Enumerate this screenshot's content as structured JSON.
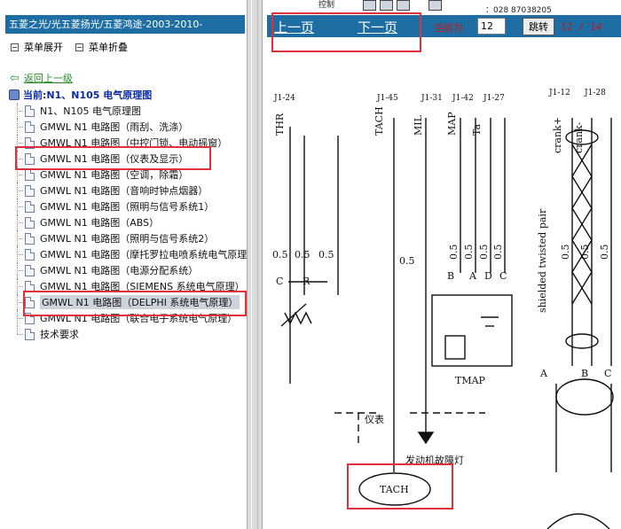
{
  "tree": {
    "title": "五菱之光/光五菱扬光/五菱鸿途-2003-2010-",
    "expand_label": "菜单展开",
    "collapse_label": "菜单折叠",
    "back_label": "返回上一级",
    "current_path": "当前:N1、N105 电气原理图",
    "items": [
      {
        "label": "N1、N105 电气原理图"
      },
      {
        "label": "GMWL N1 电路图（雨刮、洗涤）"
      },
      {
        "label": "GMWL N1 电路图（中控门锁、电动摇窗）"
      },
      {
        "label": "GMWL N1 电路图（仪表及显示）"
      },
      {
        "label": "GMWL N1 电路图（空调，除霜）"
      },
      {
        "label": "GMWL N1 电路图（音响时钟点烟器）"
      },
      {
        "label": "GMWL N1 电路图（照明与信号系统1）"
      },
      {
        "label": "GMWL N1 电路图（ABS）"
      },
      {
        "label": "GMWL N1 电路图（照明与信号系统2）"
      },
      {
        "label": "GMWL N1 电路图（摩托罗拉电喷系统电气原理"
      },
      {
        "label": "GMWL N1 电路图（电源分配系统）"
      },
      {
        "label": "GMWL N1 电路图（SIEMENS 系统电气原理）"
      },
      {
        "label": "GMWL N1 电路图（DELPHI 系统电气原理）"
      },
      {
        "label": "GMWL N1 电路图（联合电子系统电气原理）"
      },
      {
        "label": "技术要求"
      }
    ]
  },
  "toolbar": {
    "partial_left": "控制",
    "partial_right": "：028 87038205"
  },
  "pager": {
    "prev_label": "上一页",
    "next_label": "下一页",
    "current_label": "当前为",
    "current_value": "12",
    "jump_label": "跳转",
    "page_count": "12 / 14"
  },
  "diagram": {
    "connectors": [
      "J1-24",
      "J1-45",
      "J1-31",
      "J1-42",
      "J1-27",
      "J1-12",
      "J1-28"
    ],
    "signals": [
      "THR",
      "TACH",
      "MIL",
      "MAP",
      "Ta",
      "crank+",
      "crank-"
    ],
    "wire_sizes": [
      "0.5",
      "0.5",
      "0.5",
      "0.5",
      "0.5",
      "0.5",
      "0.5",
      "0.5",
      "0.5",
      "0.5",
      "0.5"
    ],
    "pins": [
      "C",
      "R",
      "B",
      "A",
      "D",
      "C",
      "A",
      "B",
      "C"
    ],
    "shielded_label": "shielded twisted pair",
    "tmap_label": "TMAP",
    "instrument_label": "仪表",
    "engine_fault_label": "发动机故障灯",
    "tach_label": "TACH"
  }
}
